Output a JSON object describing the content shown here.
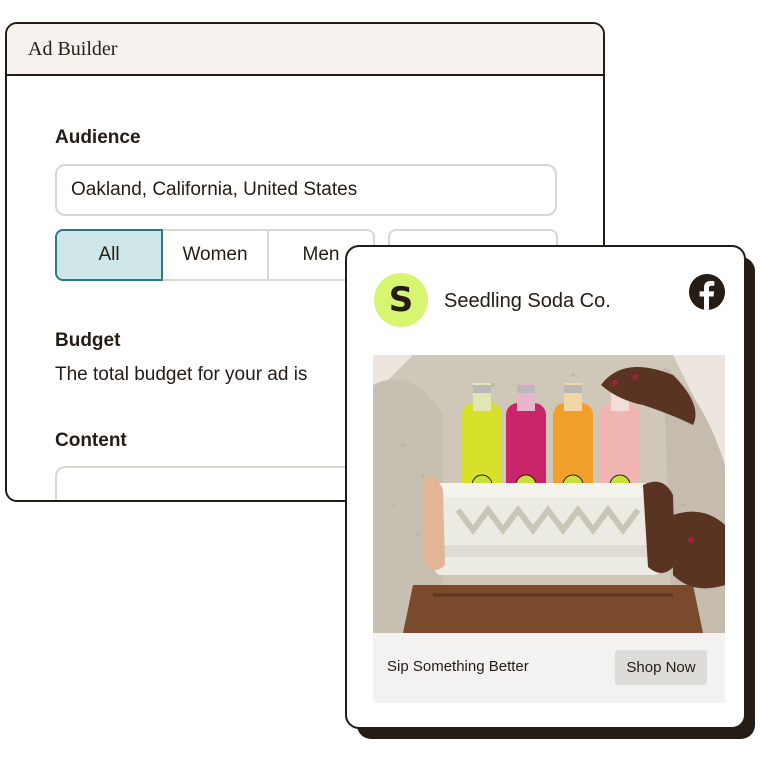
{
  "builder": {
    "title": "Ad Builder",
    "audience": {
      "heading": "Audience",
      "location_value": "Oakland, California, United States",
      "segments": [
        {
          "label": "All",
          "selected": true
        },
        {
          "label": "Women",
          "selected": false
        },
        {
          "label": "Men",
          "selected": false
        }
      ]
    },
    "budget": {
      "heading": "Budget",
      "description": "The total budget for your ad is"
    },
    "content": {
      "heading": "Content"
    }
  },
  "ad_preview": {
    "avatar_letter": "S",
    "brand_name": "Seedling Soda Co.",
    "platform_icon": "facebook-icon",
    "photo_alt": "Hands holding a crate of four Seedling soda bottles",
    "tagline": "Sip Something Better",
    "cta_label": "Shop Now"
  },
  "colors": {
    "ink": "#241c15",
    "selected_fill": "#cfe6e8",
    "selected_border": "#2a7c84",
    "avatar": "#d7f570",
    "titlebar": "#f6f3ee"
  }
}
